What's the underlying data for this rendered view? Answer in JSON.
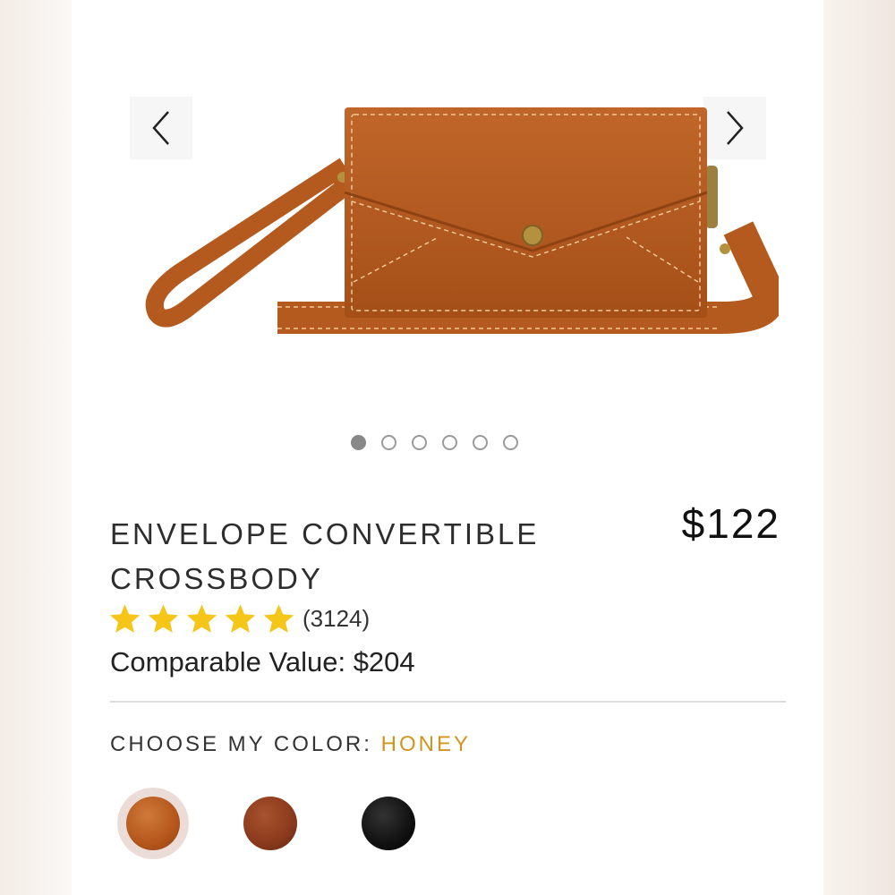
{
  "carousel": {
    "prev_icon": "chevron-left-icon",
    "next_icon": "chevron-right-icon",
    "slide_count": 6,
    "active_slide": 1
  },
  "product": {
    "title_line1": "ENVELOPE CONVERTIBLE",
    "title_line2": "CROSSBODY",
    "price": "$122",
    "rating_stars": 5,
    "review_count": "(3124)",
    "comparable_value": "Comparable Value: $204"
  },
  "color_picker": {
    "label": "CHOOSE MY COLOR:",
    "selected": "HONEY",
    "selected_color": "#d1951f",
    "swatches": [
      {
        "color": "#b5561c",
        "selected": true
      },
      {
        "color": "#8a3a1c",
        "selected": false
      },
      {
        "color": "#111111",
        "selected": false
      }
    ]
  },
  "colors": {
    "star": "#f5c518",
    "leather": "#b65a1d"
  }
}
